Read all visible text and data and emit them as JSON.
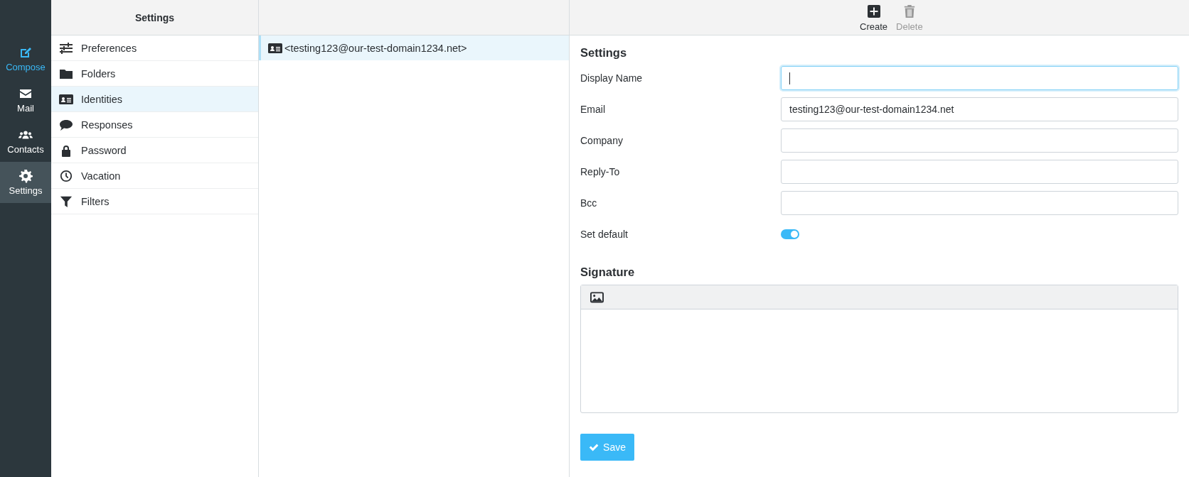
{
  "nav": [
    {
      "label": "Compose",
      "kind": "compose",
      "selected": false
    },
    {
      "label": "Mail",
      "kind": "mail",
      "selected": false
    },
    {
      "label": "Contacts",
      "kind": "contacts",
      "selected": false
    },
    {
      "label": "Settings",
      "kind": "settings",
      "selected": true
    }
  ],
  "settings_list": {
    "title": "Settings",
    "items": [
      {
        "label": "Preferences",
        "kind": "sliders",
        "selected": false
      },
      {
        "label": "Folders",
        "kind": "folder",
        "selected": false
      },
      {
        "label": "Identities",
        "kind": "idcard",
        "selected": true
      },
      {
        "label": "Responses",
        "kind": "bubble",
        "selected": false
      },
      {
        "label": "Password",
        "kind": "lock",
        "selected": false
      },
      {
        "label": "Vacation",
        "kind": "clock",
        "selected": false
      },
      {
        "label": "Filters",
        "kind": "funnel",
        "selected": false
      }
    ]
  },
  "identities": [
    {
      "label": "<testing123@our-test-domain1234.net>",
      "selected": true
    }
  ],
  "toolbar": [
    {
      "label": "Create",
      "kind": "create",
      "disabled": false
    },
    {
      "label": "Delete",
      "kind": "delete",
      "disabled": true
    }
  ],
  "form": {
    "title": "Settings",
    "fields": [
      {
        "label": "Display Name",
        "kind": "text",
        "focused": true
      },
      {
        "label": "Email",
        "kind": "text",
        "value": "testing123@our-test-domain1234.net",
        "focused": false
      },
      {
        "label": "Company",
        "kind": "text",
        "focused": false
      },
      {
        "label": "Reply-To",
        "kind": "text",
        "focused": false
      },
      {
        "label": "Bcc",
        "kind": "text",
        "focused": false
      },
      {
        "label": "Set default",
        "kind": "toggle",
        "on": true
      }
    ],
    "signature_title": "Signature",
    "save": "Save"
  }
}
